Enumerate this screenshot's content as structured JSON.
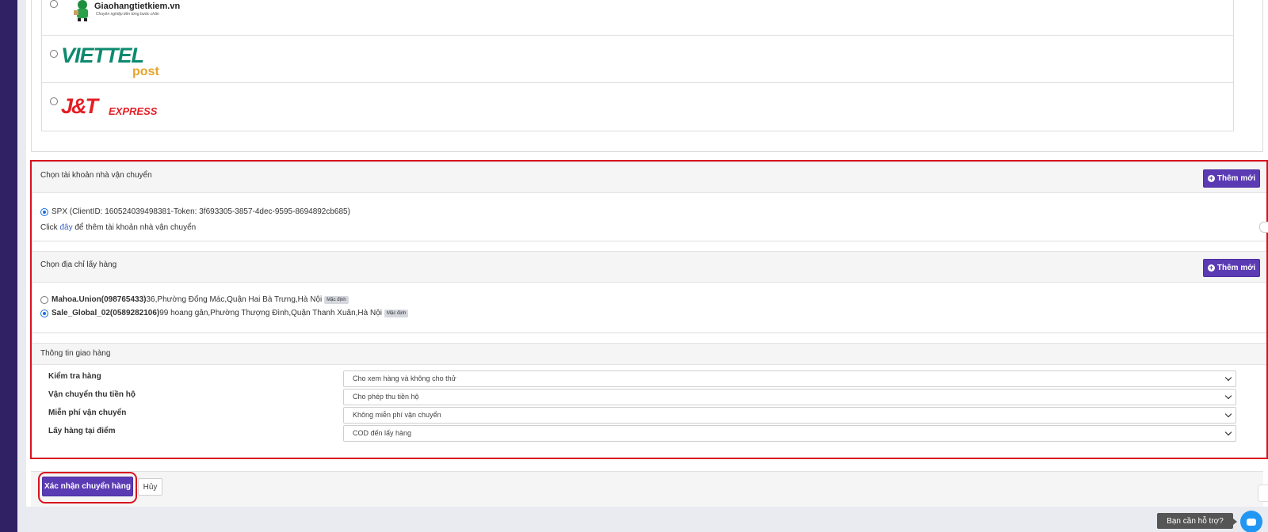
{
  "carriers": [
    {
      "name": "Giaohangtietkiem.vn",
      "tagline": "Chuyên nghiệp tiên từng bước chân"
    },
    {
      "name_main": "VIETTEL",
      "name_sub": "post"
    },
    {
      "name_main": "J&T",
      "name_sub": "EXPRESS"
    }
  ],
  "account_section": {
    "title": "Chọn tài khoản nhà vận chuyển",
    "add_label": "Thêm mới",
    "account_text": "SPX (ClientID: 160524039498381-Token: 3f693305-3857-4dec-9595-8694892cb685)",
    "note_prefix": "Click ",
    "note_link": "đây",
    "note_suffix": " để thêm tài khoản nhà vận chuyển"
  },
  "pickup_section": {
    "title": "Chọn địa chỉ lấy hàng",
    "add_label": "Thêm mới",
    "addresses": [
      {
        "name": "Mahoa.Union(098765433)",
        "address": " 36,Phường Đống Mác,Quận Hai Bà Trưng,Hà Nội",
        "badge": "Mặc định",
        "selected": false
      },
      {
        "name": "Sale_Global_02(0589282106)",
        "address": " 99 hoang gân,Phường Thượng Đình,Quận Thanh Xuân,Hà Nội",
        "badge": "Mặc định",
        "selected": true
      }
    ]
  },
  "delivery_section": {
    "title": "Thông tin giao hàng",
    "fields": [
      {
        "label": "Kiểm tra hàng",
        "value": "Cho xem hàng và không cho thử"
      },
      {
        "label": "Vận chuyển thu tiền hộ",
        "value": "Cho phép thu tiền hộ"
      },
      {
        "label": "Miễn phí vận chuyển",
        "value": "Không miễn phí vận chuyển"
      },
      {
        "label": "Lấy hàng tại điểm",
        "value": "COD đến lấy hàng"
      }
    ]
  },
  "footer": {
    "confirm_label": "Xác nhận chuyển hàng",
    "cancel_label": "Hủy"
  },
  "help": {
    "label": "Bạn cần hỗ trợ?"
  },
  "colors": {
    "accent": "#5b3bb4",
    "highlight": "#d8121e",
    "sidebar": "#2f2163"
  }
}
